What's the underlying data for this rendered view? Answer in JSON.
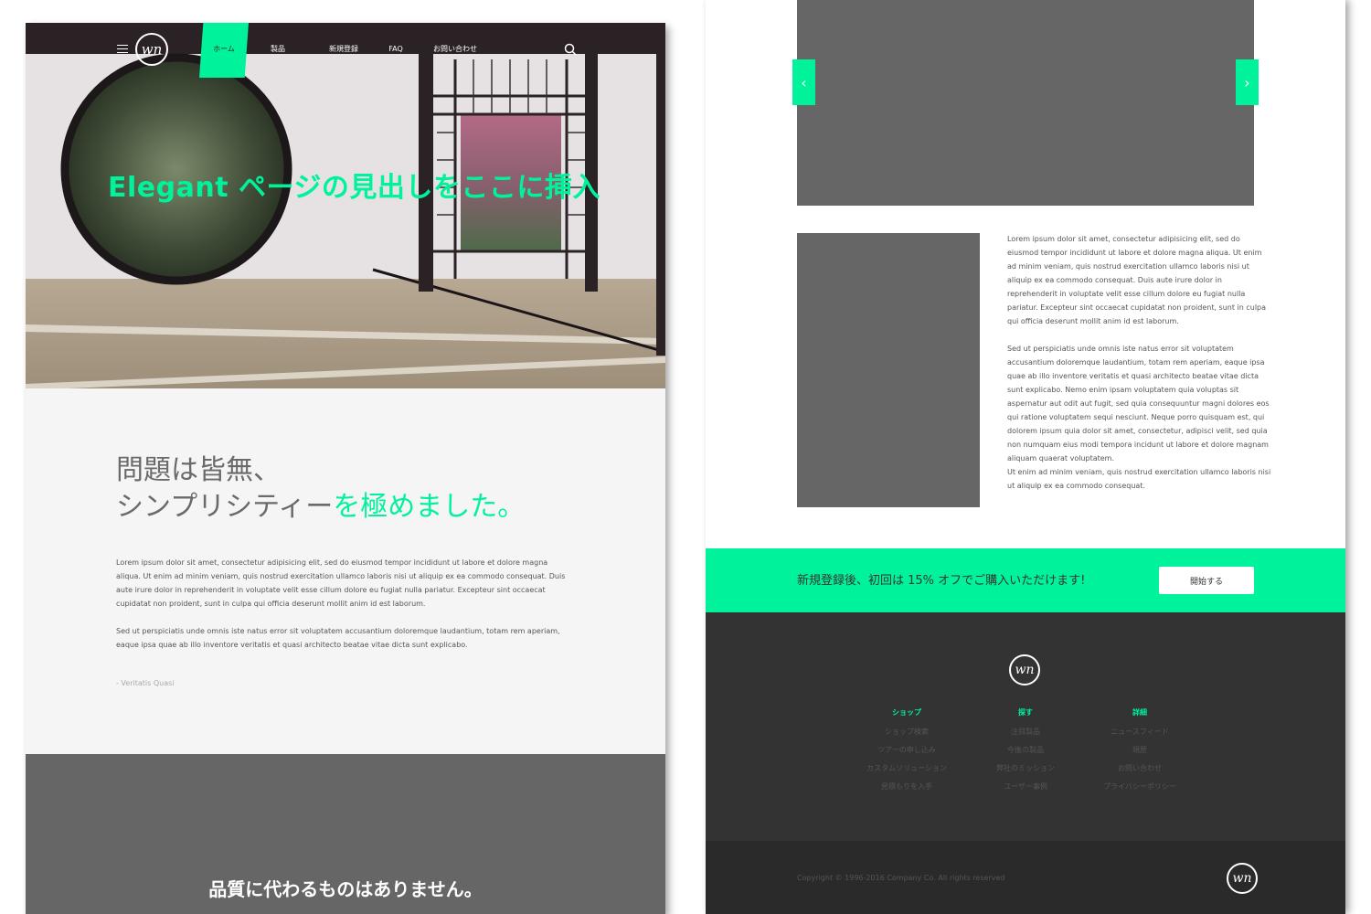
{
  "colors": {
    "accent": "#00f39b",
    "dark_gray": "#333333",
    "medium_gray": "#666666",
    "light_bg": "#f5f5f5"
  },
  "left_page": {
    "header": {
      "logo_text": "wn",
      "nav": [
        {
          "label": "ホーム",
          "active": true
        },
        {
          "label": "製品",
          "active": false
        },
        {
          "label": "新規登録",
          "active": false
        },
        {
          "label": "FAQ",
          "active": false
        },
        {
          "label": "お問い合わせ",
          "active": false
        }
      ]
    },
    "hero": {
      "title": "Elegant ページの見出しをここに挿入"
    },
    "intro": {
      "tagline_line1": "問題は皆無、",
      "tagline_line2_plain": "シンプリシティー",
      "tagline_line2_accent": "を極めました。",
      "paragraph1": "Lorem ipsum dolor sit amet, consectetur adipisicing elit, sed do eiusmod tempor incididunt ut labore et dolore magna aliqua. Ut enim ad minim veniam, quis nostrud exercitation ullamco laboris nisi ut aliquip ex ea commodo consequat. Duis aute irure dolor in reprehenderit in voluptate velit esse cillum dolore eu fugiat nulla pariatur. Excepteur sint occaecat cupidatat non proident, sunt in culpa qui officia deserunt mollit anim id est laborum.",
      "paragraph2": "Sed ut perspiciatis unde omnis iste natus error sit voluptatem accusantium doloremque laudantium, totam rem aperiam, eaque ipsa quae ab illo inventore veritatis et quasi architecto beatae vitae dicta sunt explicabo.",
      "byline": "- Veritatis Quasi"
    },
    "quality": {
      "title": "品質に代わるものはありません。"
    }
  },
  "right_page": {
    "slider": {
      "prev_icon": "chevron-left-icon",
      "next_icon": "chevron-right-icon"
    },
    "feature": {
      "paragraph1": "Lorem ipsum dolor sit amet, consectetur adipisicing elit, sed do eiusmod tempor incididunt ut labore et dolore magna aliqua. Ut enim ad minim veniam, quis nostrud exercitation ullamco laboris nisi ut aliquip ex ea commodo consequat. Duis aute irure dolor in reprehenderit in voluptate velit esse cillum dolore eu fugiat nulla pariatur. Excepteur sint occaecat cupidatat non proident, sunt in culpa qui officia deserunt mollit anim id est laborum.",
      "paragraph2": "Sed ut perspiciatis unde omnis iste natus error sit voluptatem accusantium doloremque laudantium, totam rem aperiam, eaque ipsa quae ab illo inventore veritatis et quasi architecto beatae vitae dicta sunt explicabo. Nemo enim ipsam voluptatem quia voluptas sit aspernatur aut odit aut fugit, sed quia consequuntur magni dolores eos qui ratione voluptatem sequi nesciunt. Neque porro quisquam est, qui dolorem ipsum quia dolor sit amet, consectetur, adipisci velit, sed quia non numquam eius modi tempora incidunt ut labore et dolore magnam aliquam quaerat voluptatem.",
      "paragraph3": "Ut enim ad minim veniam, quis nostrud exercitation ullamco laboris nisi ut aliquip ex ea commodo consequat."
    },
    "promo": {
      "text": "新規登録後、初回は 15% オフでご購入いただけます!",
      "button_label": "開始する"
    },
    "footer": {
      "logo_text": "wn",
      "columns": [
        {
          "title": "ショップ",
          "links": [
            "ショップ検索",
            "ツアーの申し込み",
            "カスタムソリューション",
            "見積もりを入手"
          ]
        },
        {
          "title": "探す",
          "links": [
            "注目製品",
            "今後の製品",
            "弊社のミッション",
            "ユーザー事例"
          ]
        },
        {
          "title": "詳細",
          "links": [
            "ニュースフィード",
            "規歴",
            "お問い合わせ",
            "プライバシーポリシー"
          ]
        }
      ],
      "copyright": "Copyright © 1996-2016 Company Co. All rights reserved"
    }
  }
}
